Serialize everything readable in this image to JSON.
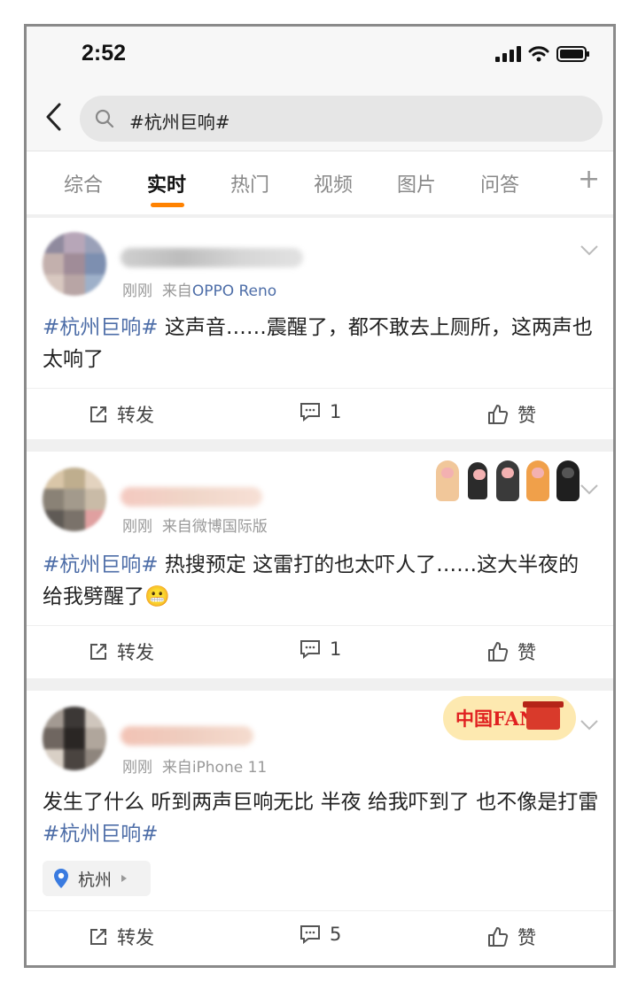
{
  "status_bar": {
    "time": "2:52"
  },
  "search": {
    "query": "#杭州巨响#"
  },
  "tabs": [
    {
      "label": "综合",
      "active": false
    },
    {
      "label": "实时",
      "active": true
    },
    {
      "label": "热门",
      "active": false
    },
    {
      "label": "视频",
      "active": false
    },
    {
      "label": "图片",
      "active": false
    },
    {
      "label": "问答",
      "active": false
    }
  ],
  "tab_plus": "+",
  "accent_color": "#ff8200",
  "link_color": "#4e6ea8",
  "posts": [
    {
      "time": "刚刚",
      "source_prefix": "来自",
      "source": "OPPO Reno",
      "hashtag": "#杭州巨响#",
      "text": " 这声音……震醒了，都不敢去上厕所，这两声也太响了",
      "repost_label": "转发",
      "comment_count": "1",
      "like_label": "赞"
    },
    {
      "time": "刚刚",
      "source_prefix": "来自",
      "source": "微博国际版",
      "hashtag": "#杭州巨响#",
      "text": " 热搜预定 这雷打的也太吓人了……这大半夜的给我劈醒了",
      "emoji": "😬",
      "repost_label": "转发",
      "comment_count": "1",
      "like_label": "赞"
    },
    {
      "time": "刚刚",
      "source_prefix": "来自",
      "source": "iPhone 11",
      "text": "发生了什么 听到两声巨响无比 半夜 给我吓到了 也不像是打雷",
      "hashtag": "#杭州巨响#",
      "location": "杭州",
      "badge": "中国FANS",
      "repost_label": "转发",
      "comment_count": "5",
      "like_label": "赞"
    }
  ]
}
